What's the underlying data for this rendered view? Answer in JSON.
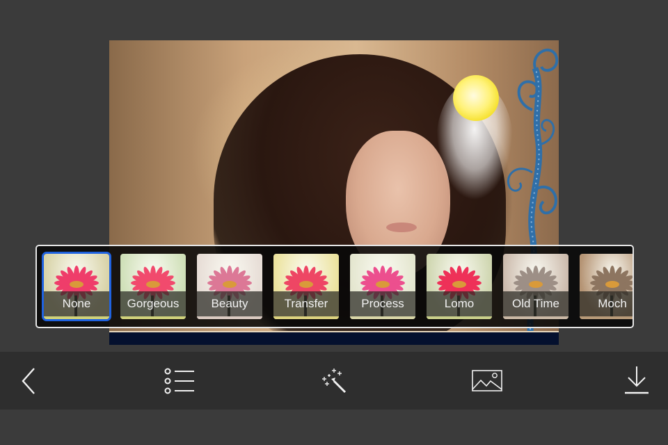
{
  "app": {
    "screen": "photo-filter-editor"
  },
  "filters": {
    "selected_index": 0,
    "items": [
      {
        "label": "None",
        "tint": "#d8d3a8",
        "petal": "#ef3d6a",
        "bottom": "#cfd17a"
      },
      {
        "label": "Gorgeous",
        "tint": "#cfe0b8",
        "petal": "#f14a6d",
        "bottom": "#cfd17a"
      },
      {
        "label": "Beauty",
        "tint": "#e7ddd6",
        "petal": "#dc7896",
        "bottom": "#d9c9c0"
      },
      {
        "label": "Transfer",
        "tint": "#ece39e",
        "petal": "#ee4664",
        "bottom": "#dcd27e"
      },
      {
        "label": "Process",
        "tint": "#e4e6cf",
        "petal": "#ec4f8e",
        "bottom": "#d8d5a6"
      },
      {
        "label": "Lomo",
        "tint": "#cfd6b0",
        "petal": "#ee3158",
        "bottom": "#c9cf8a"
      },
      {
        "label": "Old Time",
        "tint": "#cdbcae",
        "petal": "#9d8f86",
        "bottom": "#c9b7a4"
      },
      {
        "label": "Moch",
        "tint": "#b59474",
        "petal": "#8d7560",
        "bottom": "#b89a78"
      }
    ]
  },
  "toolbar": {
    "items": [
      {
        "name": "back",
        "icon": "chevron-left-icon"
      },
      {
        "name": "list",
        "icon": "list-icon"
      },
      {
        "name": "effects",
        "icon": "magic-wand-icon"
      },
      {
        "name": "gallery",
        "icon": "image-icon"
      },
      {
        "name": "save",
        "icon": "download-icon"
      }
    ]
  },
  "colors": {
    "selected_border": "#1f62e0",
    "toolbar_bg": "#2e2e2e",
    "page_bg": "#3b3b3b",
    "frame_bottom": "#04102e",
    "frame_swirl": "#2f6fa8"
  }
}
